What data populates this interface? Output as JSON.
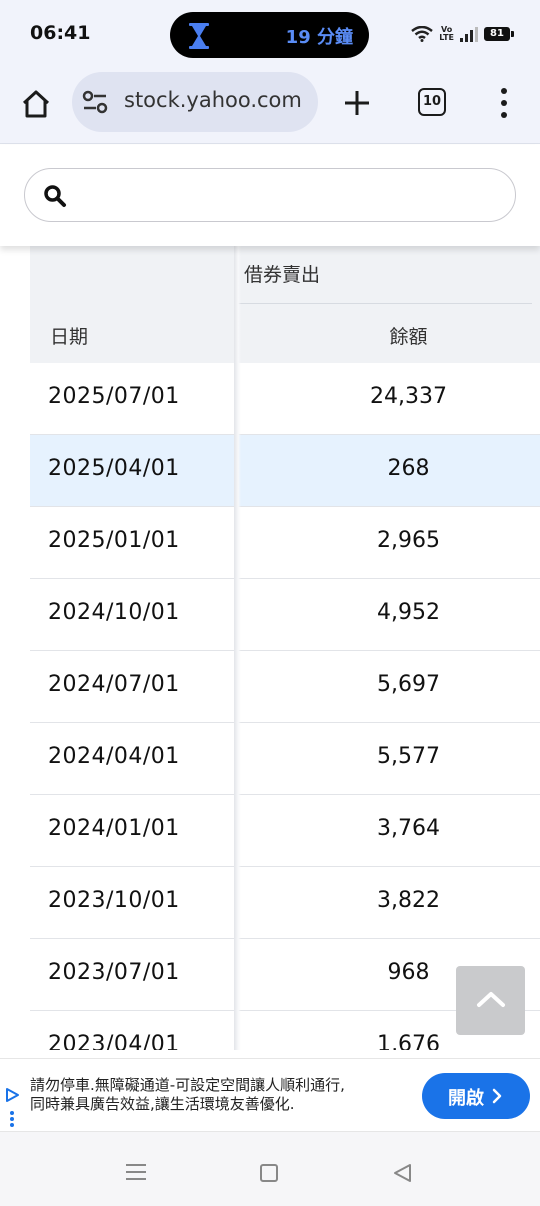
{
  "status_bar": {
    "time": "06:41",
    "timer_text": "19 分鐘",
    "network_label_top": "Vo",
    "network_label_bottom": "LTE",
    "battery": "81"
  },
  "browser": {
    "url": "stock.yahoo.com",
    "tab_count": "10"
  },
  "search": {
    "placeholder": "",
    "value": ""
  },
  "table": {
    "group_header": "借券賣出",
    "date_header": "日期",
    "balance_header": "餘額",
    "rows": [
      {
        "date": "2025/07/01",
        "balance": "24,337"
      },
      {
        "date": "2025/04/01",
        "balance": "268"
      },
      {
        "date": "2025/01/01",
        "balance": "2,965"
      },
      {
        "date": "2024/10/01",
        "balance": "4,952"
      },
      {
        "date": "2024/07/01",
        "balance": "5,697"
      },
      {
        "date": "2024/04/01",
        "balance": "5,577"
      },
      {
        "date": "2024/01/01",
        "balance": "3,764"
      },
      {
        "date": "2023/10/01",
        "balance": "3,822"
      },
      {
        "date": "2023/07/01",
        "balance": "968"
      },
      {
        "date": "2023/04/01",
        "balance": "1,676"
      }
    ],
    "highlighted_row_index": 1
  },
  "ad": {
    "line1": "請勿停車.無障礙通道-可設定空間讓人順利通行,",
    "line2": "同時兼具廣告效益,讓生活環境友善優化.",
    "button_label": "開啟"
  },
  "colors": {
    "accent": "#1a73e8",
    "row_highlight": "#e6f2fe",
    "header_bg": "#f0f2f5",
    "timer_text": "#5a8cf5"
  }
}
